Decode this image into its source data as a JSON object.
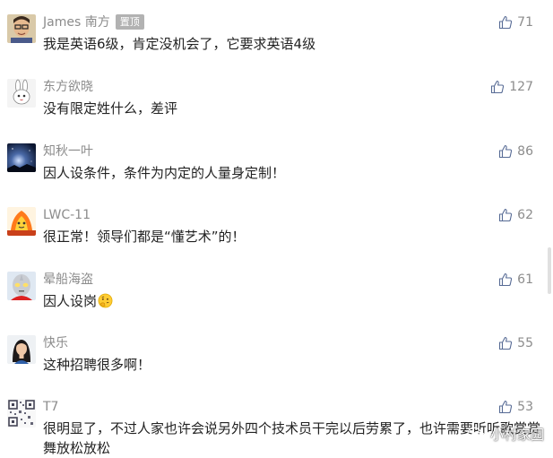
{
  "comments": [
    {
      "name": "James 南方",
      "badge": "置顶",
      "text": "我是英语6级，肯定没机会了，它要求英语4级",
      "likes": "71",
      "avatar_icon": "man-portrait-avatar"
    },
    {
      "name": "东方欲晓",
      "text": "没有限定姓什么，差评",
      "likes": "127",
      "avatar_icon": "rabbit-avatar"
    },
    {
      "name": "知秋一叶",
      "text": "因人设条件，条件为内定的人量身定制！",
      "likes": "86",
      "avatar_icon": "night-sky-avatar"
    },
    {
      "name": "LWC-11",
      "text": "很正常！领导们都是“懂艺术”的！",
      "likes": "62",
      "avatar_icon": "cartoon-fire-avatar"
    },
    {
      "name": "晕船海盗",
      "text": "因人设岗",
      "likes": "61",
      "avatar_icon": "ultraman-avatar",
      "emoji": "thinking-face-emoji"
    },
    {
      "name": "快乐",
      "text": "这种招聘很多啊！",
      "likes": "55",
      "avatar_icon": "woman-portrait-avatar"
    },
    {
      "name": "T7",
      "text": "很明显了，不过人家也许会说另外四个技术员干完以后劳累了，也许需要听听歌赏赏舞放松放松",
      "likes": "53",
      "avatar_icon": "qr-code-avatar"
    }
  ],
  "watermark": {
    "label": "小村家园",
    "icon": "wechat-icon"
  },
  "colors": {
    "name_gray": "#8c8c8c",
    "text": "#222222",
    "badge_bg": "#b2b2b2"
  }
}
